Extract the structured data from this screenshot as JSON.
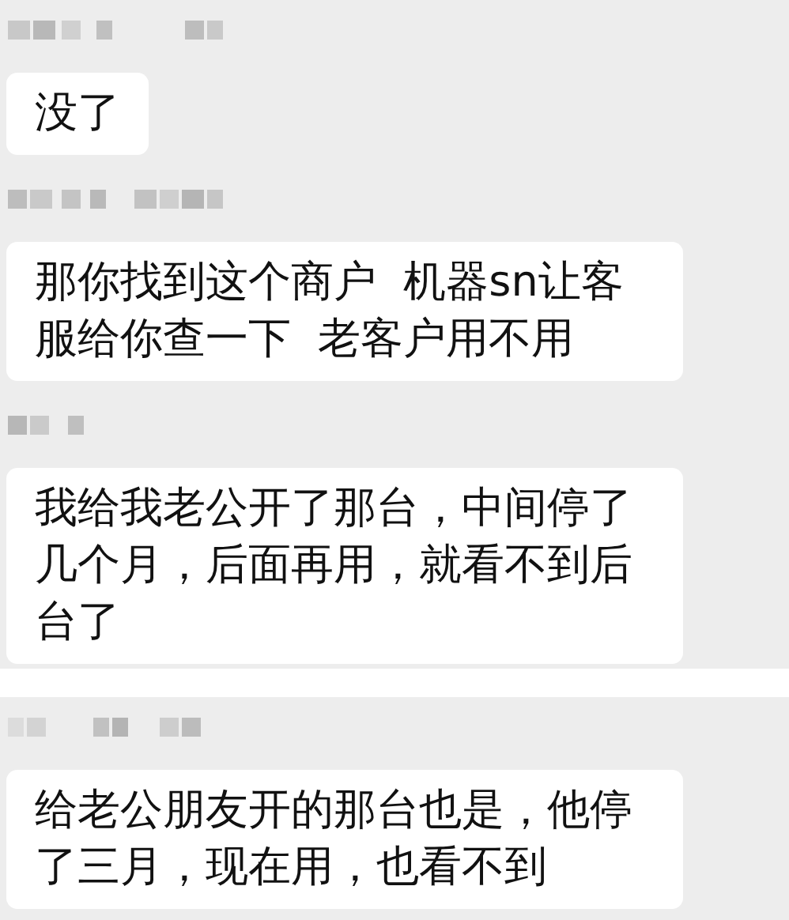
{
  "screenshots": [
    {
      "messages": [
        {
          "text": "没了"
        },
        {
          "text": "那你找到这个商户  机器sn让客服给你查一下  老客户用不用"
        },
        {
          "text": "我给我老公开了那台，中间停了几个月，后面再用，就看不到后台了"
        }
      ]
    },
    {
      "messages": [
        {
          "text": "给老公朋友开的那台也是，他停了三月，现在用，也看不到"
        }
      ]
    }
  ]
}
